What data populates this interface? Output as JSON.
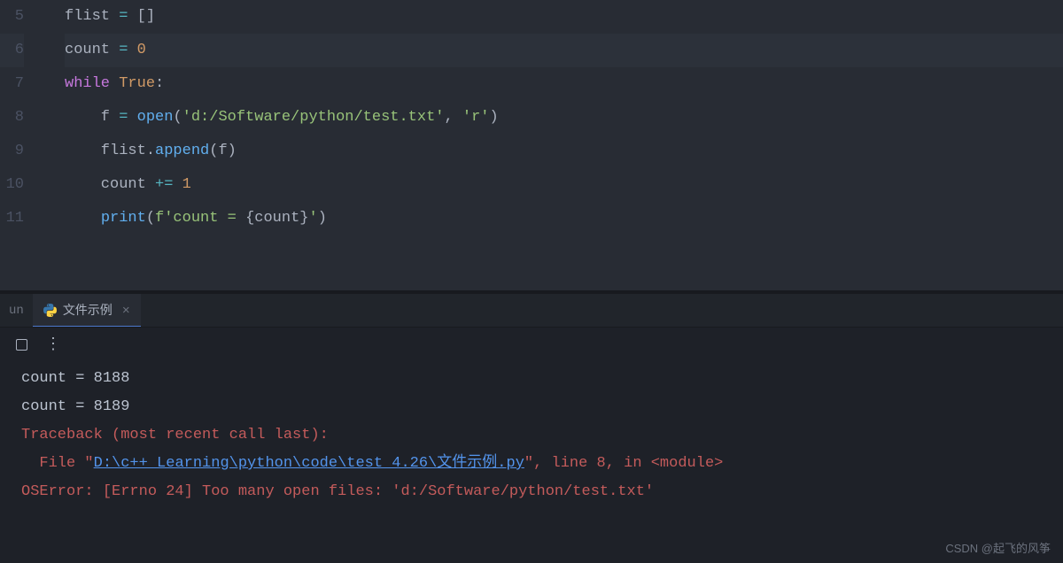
{
  "editor": {
    "lines": [
      {
        "num": "5",
        "tokens": [
          {
            "t": "flist ",
            "c": "ident"
          },
          {
            "t": "=",
            "c": "op"
          },
          {
            "t": " []",
            "c": "paren"
          }
        ]
      },
      {
        "num": "6",
        "tokens": [
          {
            "t": "count ",
            "c": "ident"
          },
          {
            "t": "=",
            "c": "op"
          },
          {
            "t": " ",
            "c": ""
          },
          {
            "t": "0",
            "c": "num"
          }
        ],
        "hl": true
      },
      {
        "num": "7",
        "tokens": [
          {
            "t": "while",
            "c": "kw"
          },
          {
            "t": " ",
            "c": ""
          },
          {
            "t": "True",
            "c": "const"
          },
          {
            "t": ":",
            "c": "paren"
          }
        ]
      },
      {
        "num": "8",
        "tokens": [
          {
            "t": "    f ",
            "c": "ident"
          },
          {
            "t": "=",
            "c": "op"
          },
          {
            "t": " ",
            "c": ""
          },
          {
            "t": "open",
            "c": "fn"
          },
          {
            "t": "(",
            "c": "paren"
          },
          {
            "t": "'d:/Software/python/test.txt'",
            "c": "str"
          },
          {
            "t": ", ",
            "c": "paren"
          },
          {
            "t": "'r'",
            "c": "str"
          },
          {
            "t": ")",
            "c": "paren"
          }
        ]
      },
      {
        "num": "9",
        "tokens": [
          {
            "t": "    flist.",
            "c": "ident"
          },
          {
            "t": "append",
            "c": "fn"
          },
          {
            "t": "(f)",
            "c": "paren"
          }
        ]
      },
      {
        "num": "10",
        "tokens": [
          {
            "t": "    count ",
            "c": "ident"
          },
          {
            "t": "+=",
            "c": "op"
          },
          {
            "t": " ",
            "c": ""
          },
          {
            "t": "1",
            "c": "num"
          }
        ]
      },
      {
        "num": "11",
        "tokens": [
          {
            "t": "    ",
            "c": ""
          },
          {
            "t": "print",
            "c": "fn"
          },
          {
            "t": "(",
            "c": "paren"
          },
          {
            "t": "f'count = ",
            "c": "fstr"
          },
          {
            "t": "{",
            "c": "paren"
          },
          {
            "t": "count",
            "c": "ident"
          },
          {
            "t": "}",
            "c": "paren"
          },
          {
            "t": "'",
            "c": "fstr"
          },
          {
            "t": ")",
            "c": "paren"
          }
        ]
      }
    ]
  },
  "terminal": {
    "prefix": "un",
    "tab_label": "文件示例",
    "output": [
      {
        "type": "normal",
        "text": "count = 8188"
      },
      {
        "type": "normal",
        "text": "count = 8189"
      },
      {
        "type": "error",
        "text": "Traceback (most recent call last):"
      },
      {
        "type": "file",
        "prefix": "  File \"",
        "link": "D:\\c++ Learning\\python\\code\\test 4.26\\文件示例.py",
        "suffix": "\", line 8, in <module>"
      },
      {
        "type": "error",
        "text": "OSError: [Errno 24] Too many open files: 'd:/Software/python/test.txt'"
      }
    ]
  },
  "watermark": "CSDN @起飞的风筝"
}
